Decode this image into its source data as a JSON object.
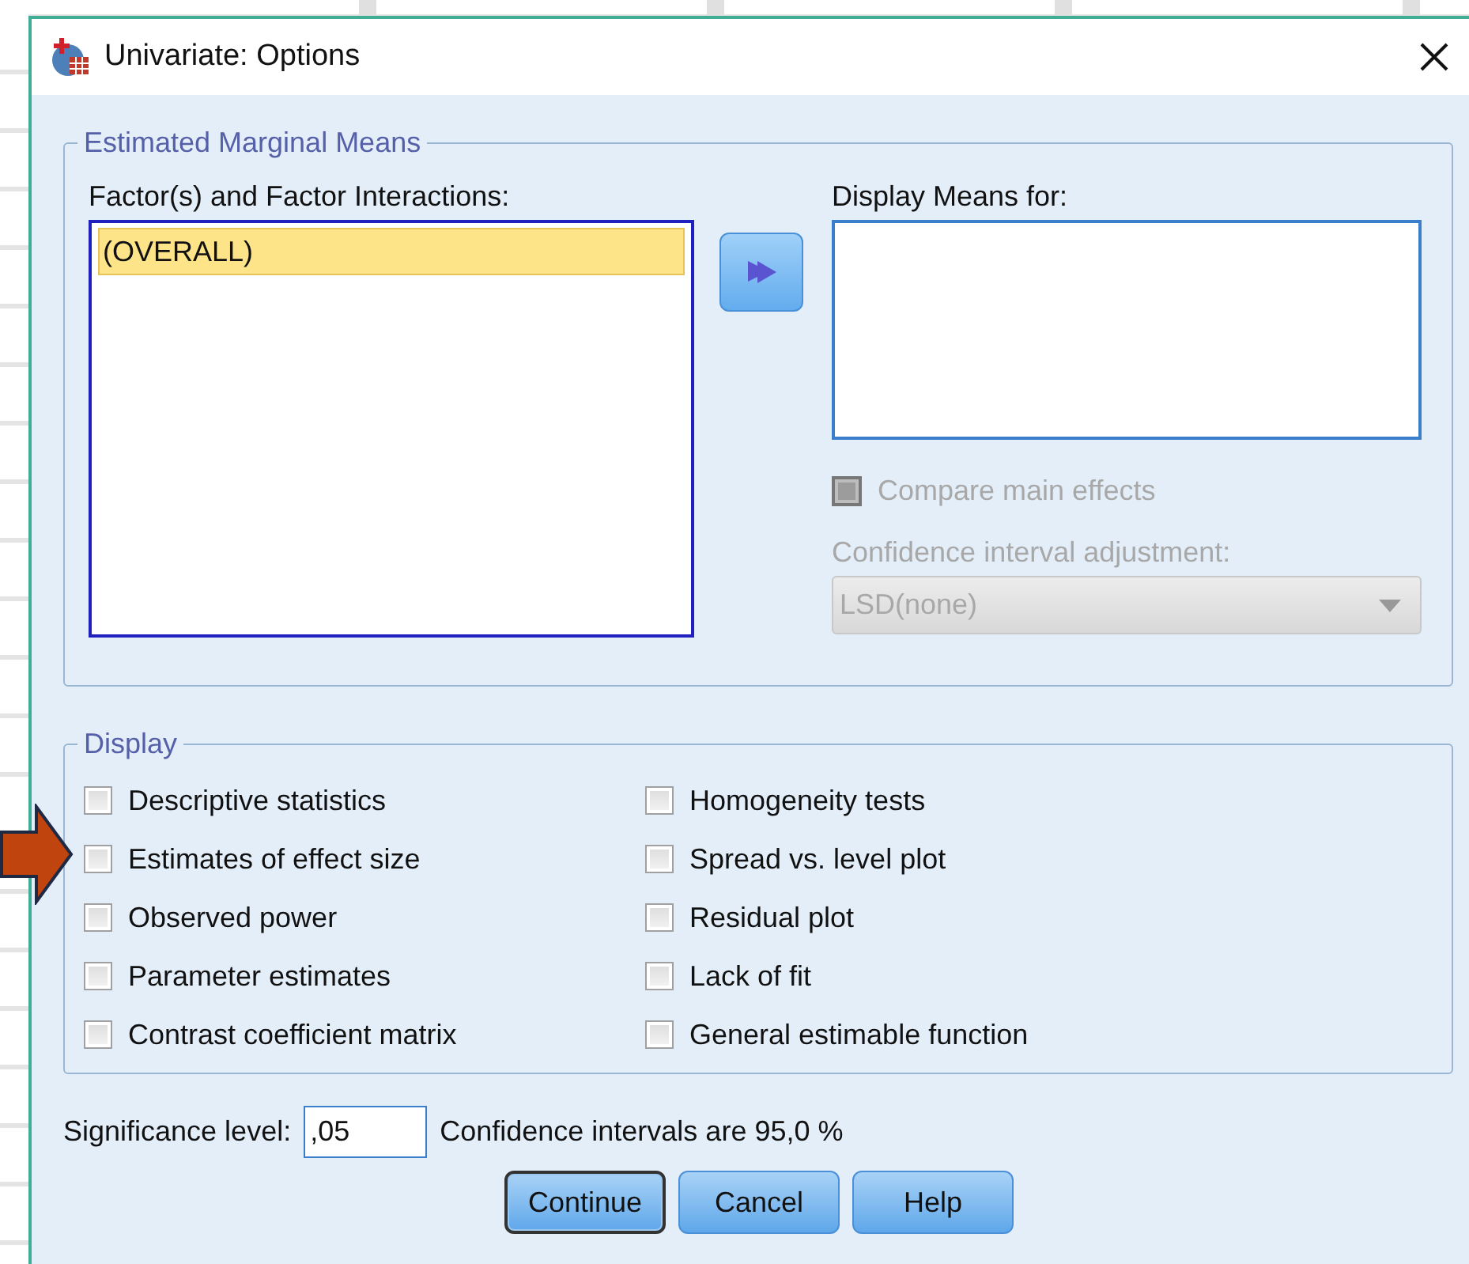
{
  "window": {
    "title": "Univariate: Options"
  },
  "estimated_marginal_means": {
    "title": "Estimated Marginal Means",
    "factors_label": "Factor(s) and Factor Interactions:",
    "factors": [
      {
        "label": "(OVERALL)",
        "selected": true
      }
    ],
    "display_means_label": "Display Means for:",
    "compare_main_effects": {
      "label": "Compare main effects",
      "checked": false,
      "disabled": true
    },
    "ci_adjustment_label": "Confidence interval adjustment:",
    "ci_adjustment": {
      "value": "LSD(none)",
      "disabled": true
    }
  },
  "display": {
    "title": "Display",
    "left_options": [
      {
        "label": "Descriptive statistics",
        "checked": false
      },
      {
        "label": "Estimates of effect size",
        "checked": false
      },
      {
        "label": "Observed power",
        "checked": false
      },
      {
        "label": "Parameter estimates",
        "checked": false
      },
      {
        "label": "Contrast coefficient matrix",
        "checked": false
      }
    ],
    "right_options": [
      {
        "label": "Homogeneity tests",
        "checked": false
      },
      {
        "label": "Spread vs. level plot",
        "checked": false
      },
      {
        "label": "Residual plot",
        "checked": false
      },
      {
        "label": "Lack of fit",
        "checked": false
      },
      {
        "label": "General estimable function",
        "checked": false
      }
    ]
  },
  "significance": {
    "label": "Significance level:",
    "value": ",05",
    "note": "Confidence intervals are 95,0 %"
  },
  "buttons": [
    {
      "label": "Continue",
      "default": true
    },
    {
      "label": "Cancel",
      "default": false
    },
    {
      "label": "Help",
      "default": false
    }
  ]
}
